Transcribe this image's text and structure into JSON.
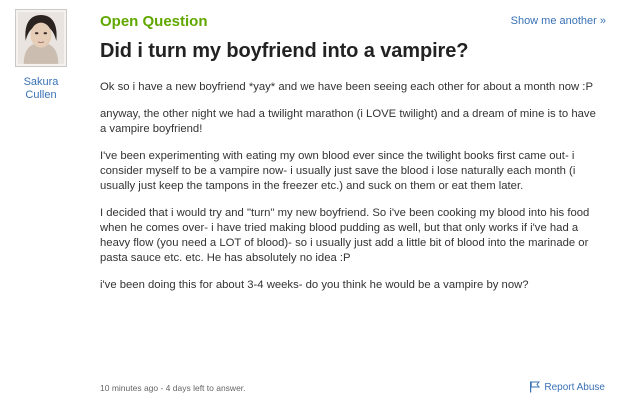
{
  "author": {
    "name_line1": "Sakura",
    "name_line2": "Cullen",
    "avatar_icon": "user-avatar-photo"
  },
  "question": {
    "status": "Open Question",
    "show_another": "Show me another »",
    "title": "Did i turn my boyfriend into a vampire?",
    "paragraphs": [
      "Ok so i have a new boyfriend *yay* and we have been seeing each other for about a month now :P",
      "anyway, the other night we had a twilight marathon (i LOVE twilight) and a dream of mine is to have a vampire boyfriend!",
      "I've been experimenting with eating my own blood ever since the twilight books first came out- i consider myself to be a vampire now- i usually just save the blood i lose naturally each month (i usually just keep the tampons in the freezer etc.) and suck on them or eat them later.",
      "I decided that i would try and \"turn\" my new boyfriend. So i've been cooking my blood into his food when he comes over- i have tried making blood pudding as well, but that only works if i've had a heavy flow (you need a LOT of blood)- so i usually just add a little bit of blood into the marinade or pasta sauce etc. etc. He has absolutely no idea :P",
      "i've been doing this for about 3-4 weeks- do you think he would be a vampire by now?"
    ]
  },
  "footer": {
    "meta": "10 minutes ago - 4 days left to answer.",
    "report_label": "Report Abuse",
    "report_icon": "flag-icon"
  },
  "colors": {
    "status_green": "#60a800",
    "link_blue": "#3a72b6"
  }
}
